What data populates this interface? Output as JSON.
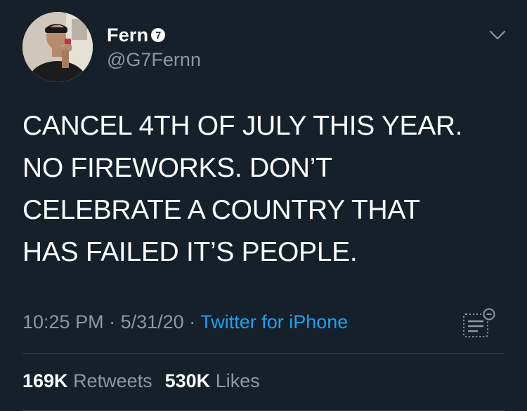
{
  "author": {
    "display_name": "Fern",
    "badge": "7",
    "handle": "@G7Fernn"
  },
  "tweet": {
    "lines": [
      "CANCEL 4TH OF JULY THIS YEAR.",
      "NO FIREWORKS. DON’T",
      "CELEBRATE A COUNTRY THAT",
      "HAS FAILED IT’S PEOPLE."
    ],
    "time": "10:25 PM",
    "separator": "·",
    "date": "5/31/20",
    "source": "Twitter for iPhone"
  },
  "stats": {
    "retweets_count": "169K",
    "retweets_label": "Retweets",
    "likes_count": "530K",
    "likes_label": "Likes"
  },
  "icons": {
    "caret": "chevron-down-icon",
    "analytics": "tweet-analytics-icon"
  },
  "colors": {
    "background": "#15202b",
    "text": "#ffffff",
    "muted": "#8899a6",
    "link": "#1da1f2",
    "divider": "#38444d"
  }
}
